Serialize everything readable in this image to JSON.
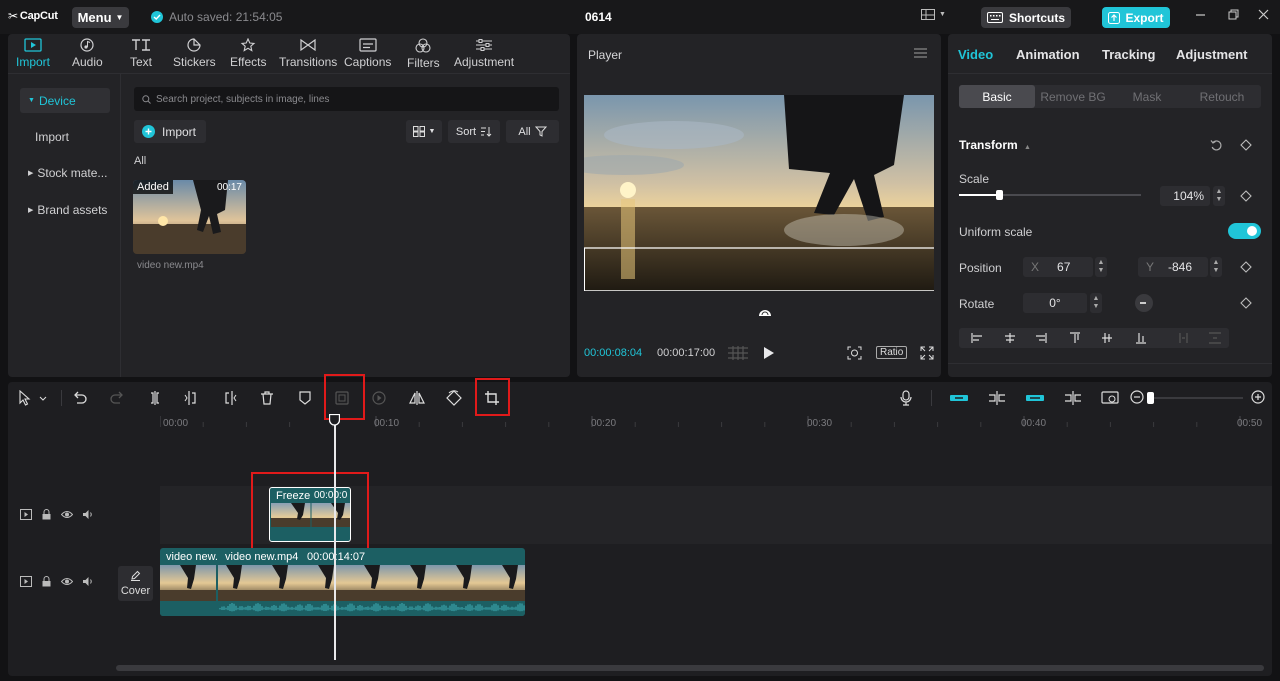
{
  "app": {
    "logo": "CapCut",
    "menu_label": "Menu",
    "autosave": "Auto saved: 21:54:05",
    "project_title": "0614",
    "shortcuts_label": "Shortcuts",
    "export_label": "Export"
  },
  "media": {
    "tabs": [
      {
        "label": "Import",
        "icon": "import-icon"
      },
      {
        "label": "Audio",
        "icon": "audio-icon"
      },
      {
        "label": "Text",
        "icon": "text-icon"
      },
      {
        "label": "Stickers",
        "icon": "stickers-icon"
      },
      {
        "label": "Effects",
        "icon": "effects-icon"
      },
      {
        "label": "Transitions",
        "icon": "transitions-icon"
      },
      {
        "label": "Captions",
        "icon": "captions-icon"
      },
      {
        "label": "Filters",
        "icon": "filters-icon"
      },
      {
        "label": "Adjustment",
        "icon": "adjustment-icon"
      }
    ],
    "nav": [
      "Device",
      "Import",
      "Stock mate...",
      "Brand assets"
    ],
    "search_placeholder": "Search project, subjects in image, lines",
    "import_button": "Import",
    "sort_label": "Sort",
    "all_filter": "All",
    "section_label": "All",
    "item": {
      "badge": "Added",
      "duration": "00:17",
      "name": "video new.mp4"
    }
  },
  "player": {
    "title": "Player",
    "current_time": "00:00:08:04",
    "duration": "00:00:17:00",
    "ratio_label": "Ratio"
  },
  "inspector": {
    "tabs": [
      "Video",
      "Animation",
      "Tracking",
      "Adjustment"
    ],
    "subtabs": [
      "Basic",
      "Remove BG",
      "Mask",
      "Retouch"
    ],
    "section": "Transform",
    "scale_label": "Scale",
    "scale_value": "104%",
    "scale_fraction": 0.22,
    "uniform_scale_label": "Uniform scale",
    "position_label": "Position",
    "pos_x_label": "X",
    "pos_x": "67",
    "pos_y_label": "Y",
    "pos_y": "-846",
    "rotate_label": "Rotate",
    "rotate_value": "0°"
  },
  "timeline": {
    "ruler": [
      "00:00",
      "00:10",
      "00:20",
      "00:30",
      "00:40",
      "00:50"
    ],
    "freeze_clip": {
      "label": "Freeze",
      "time": "00:00:0"
    },
    "main_clip_a": "video new.",
    "main_clip_b": {
      "label": "video new.mp4",
      "time": "00:00:14:07"
    },
    "cover_label": "Cover"
  },
  "colors": {
    "accent": "#20c5d8",
    "highlight": "#e01a1a",
    "clip": "#1c5f63"
  }
}
